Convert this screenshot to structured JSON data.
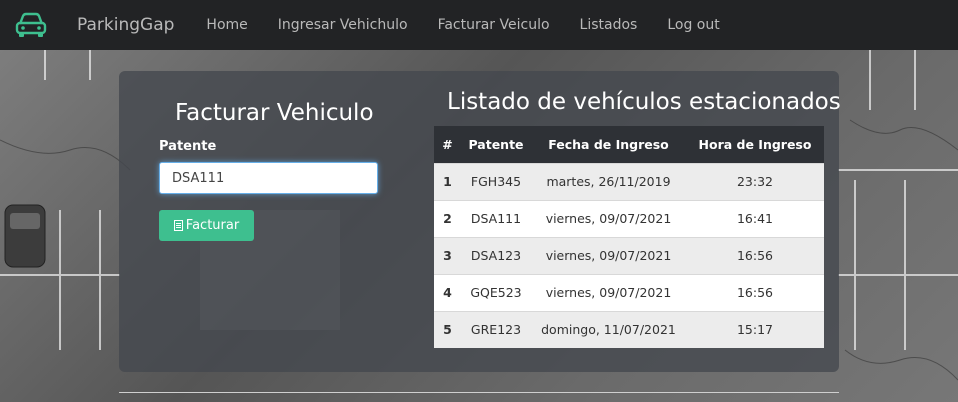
{
  "navbar": {
    "brand": "ParkingGap",
    "logo_icon": "car-icon",
    "links": [
      "Home",
      "Ingresar Vehichulo",
      "Facturar Veiculo",
      "Listados",
      "Log out"
    ]
  },
  "form": {
    "title": "Facturar Vehiculo",
    "label": "Patente",
    "value": "DSA111",
    "button_label": "Facturar",
    "button_icon": "document-icon"
  },
  "list": {
    "title": "Listado de vehículos estacionados",
    "headers": [
      "#",
      "Patente",
      "Fecha de Ingreso",
      "Hora de Ingreso"
    ],
    "rows": [
      {
        "n": "1",
        "patente": "FGH345",
        "fecha": "martes, 26/11/2019",
        "hora": "23:32"
      },
      {
        "n": "2",
        "patente": "DSA111",
        "fecha": "viernes, 09/07/2021",
        "hora": "16:41"
      },
      {
        "n": "3",
        "patente": "DSA123",
        "fecha": "viernes, 09/07/2021",
        "hora": "16:56"
      },
      {
        "n": "4",
        "patente": "GQE523",
        "fecha": "viernes, 09/07/2021",
        "hora": "16:56"
      },
      {
        "n": "5",
        "patente": "GRE123",
        "fecha": "domingo, 11/07/2021",
        "hora": "15:17"
      }
    ]
  },
  "colors": {
    "navbar_bg": "#222325",
    "accent_green": "#3ebf8f",
    "table_header_bg": "#2e3136"
  }
}
